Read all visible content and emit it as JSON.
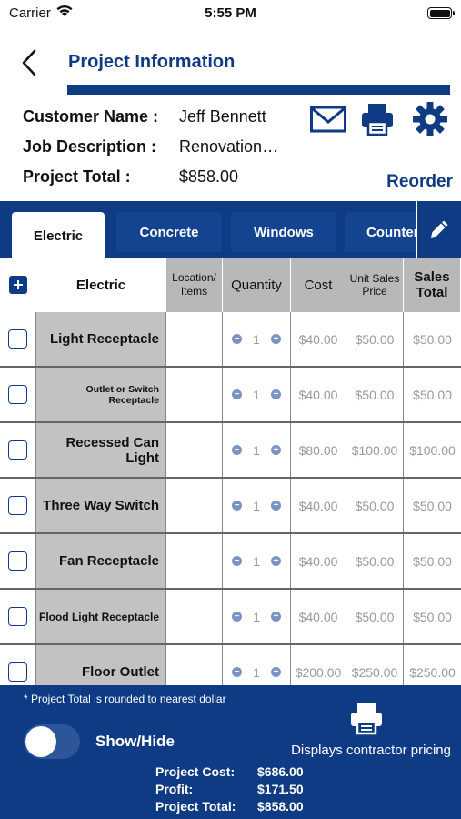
{
  "status_bar": {
    "carrier": "Carrier",
    "time": "5:55 PM"
  },
  "header": {
    "title": "Project Information",
    "reorder": "Reorder"
  },
  "project": {
    "customer_label": "Customer Name :",
    "customer_value": "Jeff Bennett",
    "job_label": "Job Description :",
    "job_value": "Renovation…",
    "total_label": "Project Total :",
    "total_value": "$858.00"
  },
  "tabs": [
    "Electric",
    "Concrete",
    "Windows",
    "Counter"
  ],
  "table": {
    "section": "Electric",
    "columns": {
      "location": "Location/ Items",
      "quantity": "Quantity",
      "cost": "Cost",
      "unit_price": "Unit Sales Price",
      "sales_total": "Sales Total"
    },
    "rows": [
      {
        "name": "Light Receptacle",
        "qty": "1",
        "cost": "$40.00",
        "unit": "$50.00",
        "total": "$50.00"
      },
      {
        "name": "Outlet or Switch Receptacle",
        "qty": "1",
        "cost": "$40.00",
        "unit": "$50.00",
        "total": "$50.00"
      },
      {
        "name": "Recessed Can Light",
        "qty": "1",
        "cost": "$80.00",
        "unit": "$100.00",
        "total": "$100.00"
      },
      {
        "name": "Three Way Switch",
        "qty": "1",
        "cost": "$40.00",
        "unit": "$50.00",
        "total": "$50.00"
      },
      {
        "name": "Fan Receptacle",
        "qty": "1",
        "cost": "$40.00",
        "unit": "$50.00",
        "total": "$50.00"
      },
      {
        "name": "Flood Light Receptacle",
        "qty": "1",
        "cost": "$40.00",
        "unit": "$50.00",
        "total": "$50.00"
      },
      {
        "name": "Floor Outlet",
        "qty": "1",
        "cost": "$200.00",
        "unit": "$250.00",
        "total": "$250.00"
      }
    ]
  },
  "footer": {
    "note": "* Project Total is rounded to nearest dollar",
    "show_hide": "Show/Hide",
    "contractor": "Displays contractor pricing",
    "cost_label": "Project Cost:",
    "cost_value": "$686.00",
    "profit_label": "Profit:",
    "profit_value": "$171.50",
    "total_label": "Project Total:",
    "total_value": "$858.00"
  },
  "colors": {
    "brand": "#0f3a84",
    "gray_cell": "#c2c2c2",
    "muted_text": "#999999"
  }
}
